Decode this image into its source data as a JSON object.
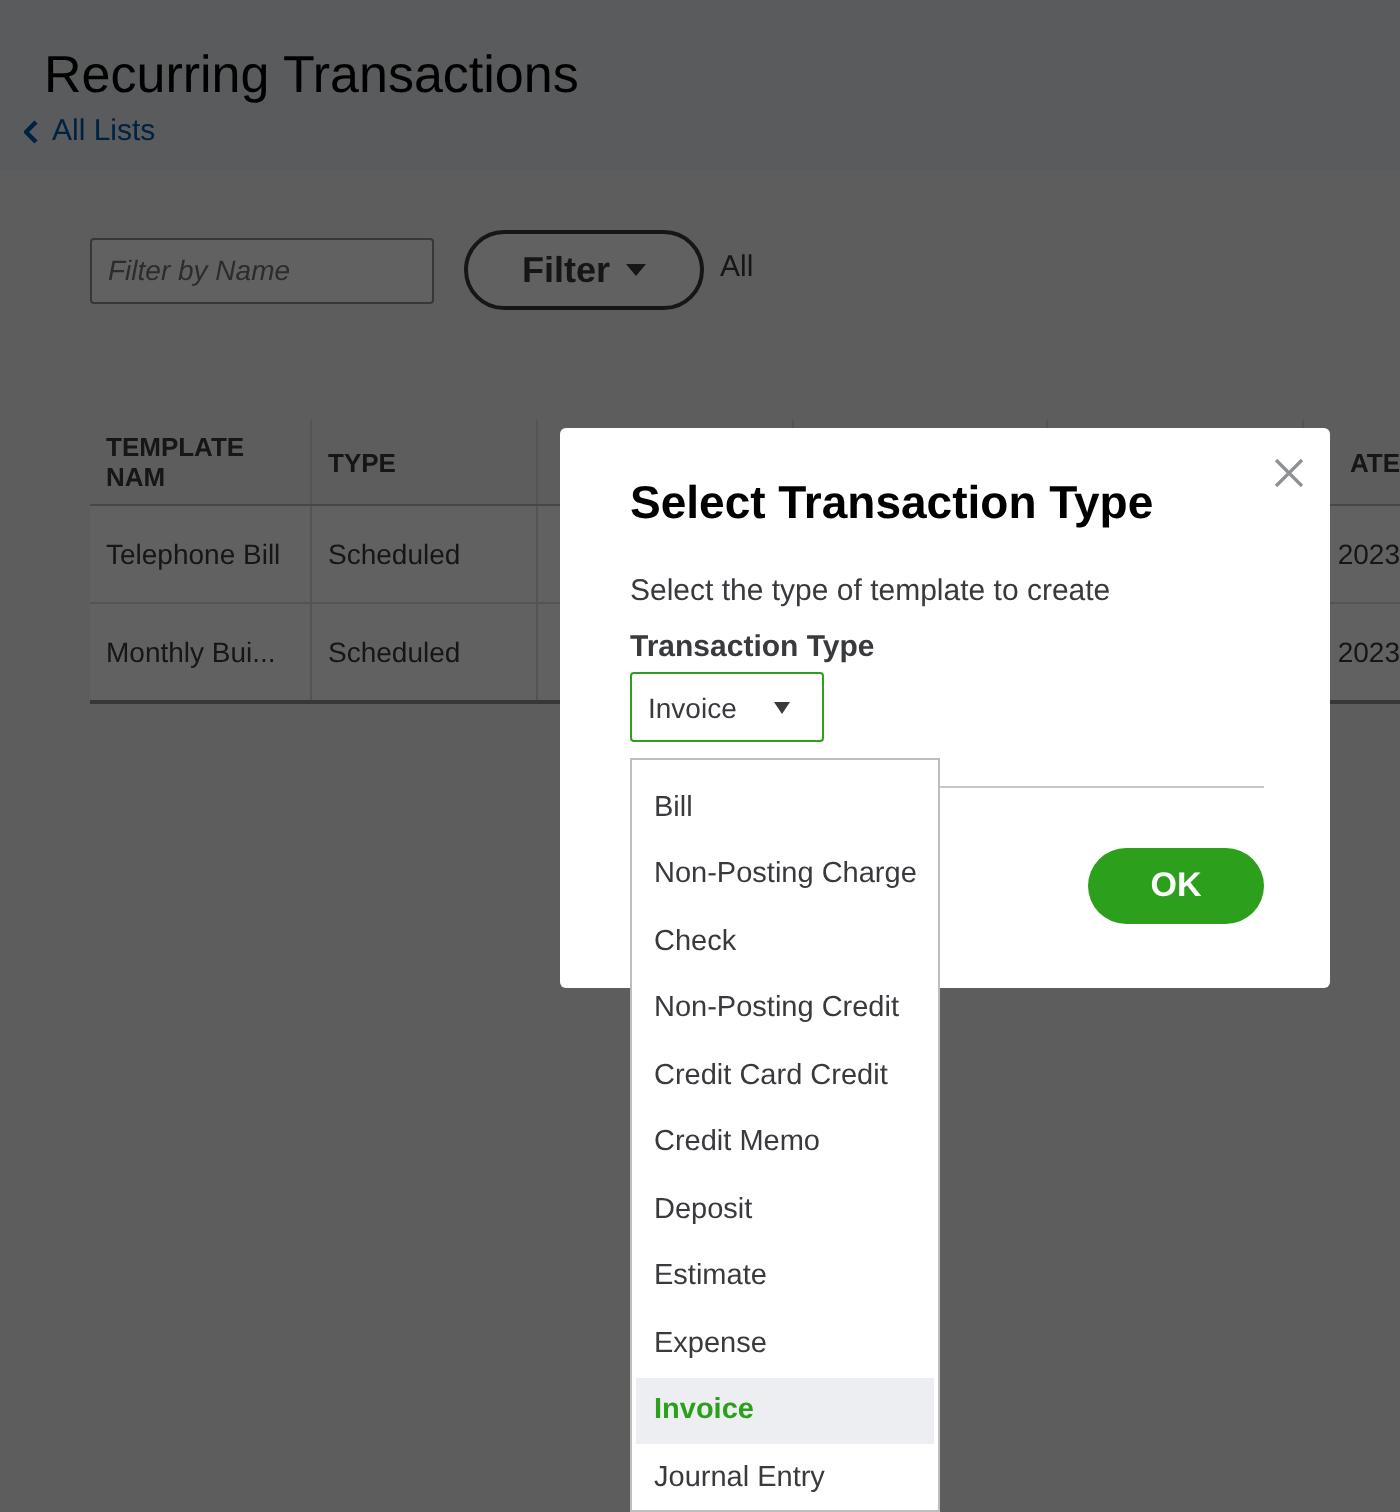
{
  "page": {
    "title": "Recurring Transactions",
    "back_link": "All Lists"
  },
  "filter": {
    "placeholder": "Filter by Name",
    "button": "Filter",
    "value": "All"
  },
  "table": {
    "columns": [
      "TEMPLATE NAM",
      "TYPE",
      "",
      "",
      "",
      "ATE"
    ],
    "rows": [
      {
        "cells": [
          "Telephone Bill",
          "Scheduled",
          "",
          "",
          "",
          "2023"
        ]
      },
      {
        "cells": [
          "Monthly Bui...",
          "Scheduled",
          "",
          "",
          "",
          "2023"
        ]
      }
    ]
  },
  "dialog": {
    "title": "Select Transaction Type",
    "subtitle": "Select the type of template to create",
    "field_label": "Transaction Type",
    "field_value": "Invoice",
    "ok_button": "OK",
    "options": [
      {
        "label": "Bill",
        "selected": false
      },
      {
        "label": "Non-Posting Charge",
        "selected": false
      },
      {
        "label": "Check",
        "selected": false
      },
      {
        "label": "Non-Posting Credit",
        "selected": false
      },
      {
        "label": "Credit Card Credit",
        "selected": false
      },
      {
        "label": "Credit Memo",
        "selected": false
      },
      {
        "label": "Deposit",
        "selected": false
      },
      {
        "label": "Estimate",
        "selected": false
      },
      {
        "label": "Expense",
        "selected": false
      },
      {
        "label": "Invoice",
        "selected": true
      },
      {
        "label": "Journal Entry",
        "selected": false
      }
    ]
  }
}
